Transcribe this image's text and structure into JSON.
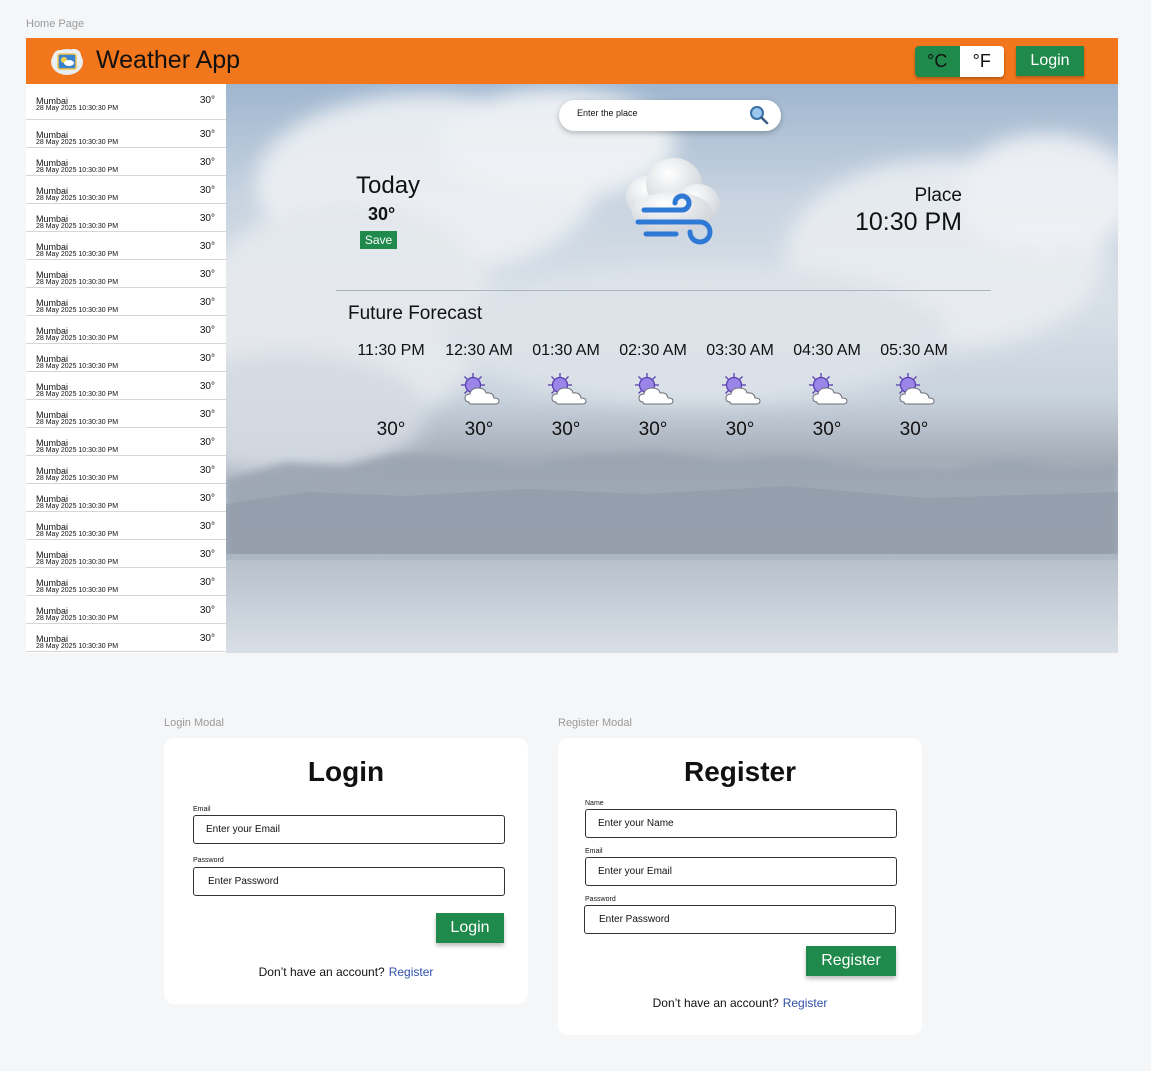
{
  "labels": {
    "home": "Home Page",
    "login_modal": "Login Modal",
    "register_modal": "Register Modal"
  },
  "colors": {
    "header": "#f2761c",
    "primary_button": "#1f8a4c",
    "link": "#2f4fa8"
  },
  "header": {
    "logo_icon": "weather-app-logo-icon",
    "title": "Weather App",
    "unit_c": "°C",
    "unit_f": "°F",
    "selected_unit": "°C",
    "login_label": "Login"
  },
  "sidebar": {
    "items": [
      {
        "city": "Mumbai",
        "datetime": "28 May 2025  10:30:30 PM",
        "temp": "30°"
      },
      {
        "city": "Mumbai",
        "datetime": "28 May 2025  10:30:30 PM",
        "temp": "30°"
      },
      {
        "city": "Mumbai",
        "datetime": "28 May 2025  10:30:30 PM",
        "temp": "30°"
      },
      {
        "city": "Mumbai",
        "datetime": "28 May 2025  10:30:30 PM",
        "temp": "30°"
      },
      {
        "city": "Mumbai",
        "datetime": "28 May 2025  10:30:30 PM",
        "temp": "30°"
      },
      {
        "city": "Mumbai",
        "datetime": "28 May 2025  10:30:30 PM",
        "temp": "30°"
      },
      {
        "city": "Mumbai",
        "datetime": "28 May 2025  10:30:30 PM",
        "temp": "30°"
      },
      {
        "city": "Mumbai",
        "datetime": "28 May 2025  10:30:30 PM",
        "temp": "30°"
      },
      {
        "city": "Mumbai",
        "datetime": "28 May 2025  10:30:30 PM",
        "temp": "30°"
      },
      {
        "city": "Mumbai",
        "datetime": "28 May 2025  10:30:30 PM",
        "temp": "30°"
      },
      {
        "city": "Mumbai",
        "datetime": "28 May 2025  10:30:30 PM",
        "temp": "30°"
      },
      {
        "city": "Mumbai",
        "datetime": "28 May 2025  10:30:30 PM",
        "temp": "30°"
      },
      {
        "city": "Mumbai",
        "datetime": "28 May 2025  10:30:30 PM",
        "temp": "30°"
      },
      {
        "city": "Mumbai",
        "datetime": "28 May 2025  10:30:30 PM",
        "temp": "30°"
      },
      {
        "city": "Mumbai",
        "datetime": "28 May 2025  10:30:30 PM",
        "temp": "30°"
      },
      {
        "city": "Mumbai",
        "datetime": "28 May 2025  10:30:30 PM",
        "temp": "30°"
      },
      {
        "city": "Mumbai",
        "datetime": "28 May 2025  10:30:30 PM",
        "temp": "30°"
      },
      {
        "city": "Mumbai",
        "datetime": "28 May 2025  10:30:30 PM",
        "temp": "30°"
      },
      {
        "city": "Mumbai",
        "datetime": "28 May 2025  10:30:30 PM",
        "temp": "30°"
      },
      {
        "city": "Mumbai",
        "datetime": "28 May 2025  10:30:30 PM",
        "temp": "30°"
      }
    ]
  },
  "search": {
    "placeholder": "Enter the place",
    "icon": "search-icon"
  },
  "current": {
    "today_label": "Today",
    "temp": "30°",
    "save_label": "Save",
    "icon": "cloud-wind-icon",
    "place": "Place",
    "time": "10:30 PM"
  },
  "forecast": {
    "title": "Future Forecast",
    "items": [
      {
        "time": "11:30 PM",
        "temp": "30°",
        "icon": ""
      },
      {
        "time": "12:30 AM",
        "temp": "30°",
        "icon": "sun-behind-cloud-icon"
      },
      {
        "time": "01:30 AM",
        "temp": "30°",
        "icon": "sun-behind-cloud-icon"
      },
      {
        "time": "02:30 AM",
        "temp": "30°",
        "icon": "sun-behind-cloud-icon"
      },
      {
        "time": "03:30 AM",
        "temp": "30°",
        "icon": "sun-behind-cloud-icon"
      },
      {
        "time": "04:30 AM",
        "temp": "30°",
        "icon": "sun-behind-cloud-icon"
      },
      {
        "time": "05:30 AM",
        "temp": "30°",
        "icon": "sun-behind-cloud-icon"
      }
    ]
  },
  "login": {
    "title": "Login",
    "email_label": "Email",
    "email_placeholder": "Enter your Email",
    "password_label": "Password",
    "password_placeholder": "Enter Password",
    "submit_label": "Login",
    "switch_text": "Don’t have an account?",
    "switch_link": "Register"
  },
  "register": {
    "title": "Register",
    "name_label": "Name",
    "name_placeholder": "Enter your Name",
    "email_label": "Email",
    "email_placeholder": "Enter your Email",
    "password_label": "Password",
    "password_placeholder": "Enter Password",
    "submit_label": "Register",
    "switch_text": "Don’t have an account?",
    "switch_link": "Register"
  }
}
